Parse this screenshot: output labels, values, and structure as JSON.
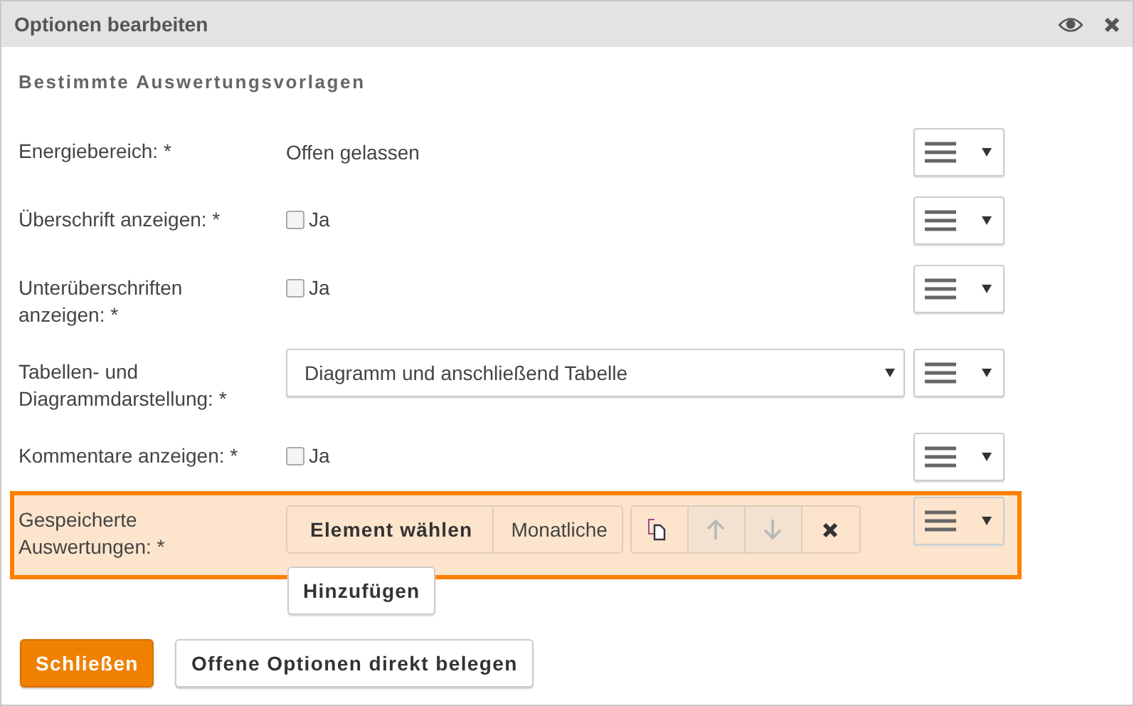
{
  "window": {
    "title": "Optionen bearbeiten"
  },
  "section_title": "Bestimmte Auswertungsvorlagen",
  "fields": [
    {
      "kind": "text",
      "label": "Energiebereich: *",
      "value": "Offen gelassen",
      "highlighted": false
    },
    {
      "kind": "checkbox",
      "label": "Überschrift anzeigen: *",
      "option": "Ja",
      "checked": false,
      "highlighted": false
    },
    {
      "kind": "checkbox",
      "label": "Unterüberschriften anzeigen: *",
      "option": "Ja",
      "checked": false,
      "highlighted": false
    },
    {
      "kind": "select",
      "label": "Tabellen- und Diagrammdarstellung: *",
      "value": "Diagramm und anschließend Tabelle",
      "highlighted": false
    },
    {
      "kind": "checkbox",
      "label": "Kommentare anzeigen: *",
      "option": "Ja",
      "checked": false,
      "highlighted": false
    },
    {
      "kind": "items",
      "label": "Gespeicherte Auswertungen: *",
      "item_button": "Element wählen",
      "item_value": "Monatliche",
      "move_up_disabled": true,
      "move_down_disabled": true,
      "add_button": "Hinzufügen",
      "highlighted": true
    }
  ],
  "buttons": [
    {
      "label": "Schließen",
      "primary": true
    },
    {
      "label": "Offene Optionen direkt belegen",
      "primary": false
    }
  ]
}
